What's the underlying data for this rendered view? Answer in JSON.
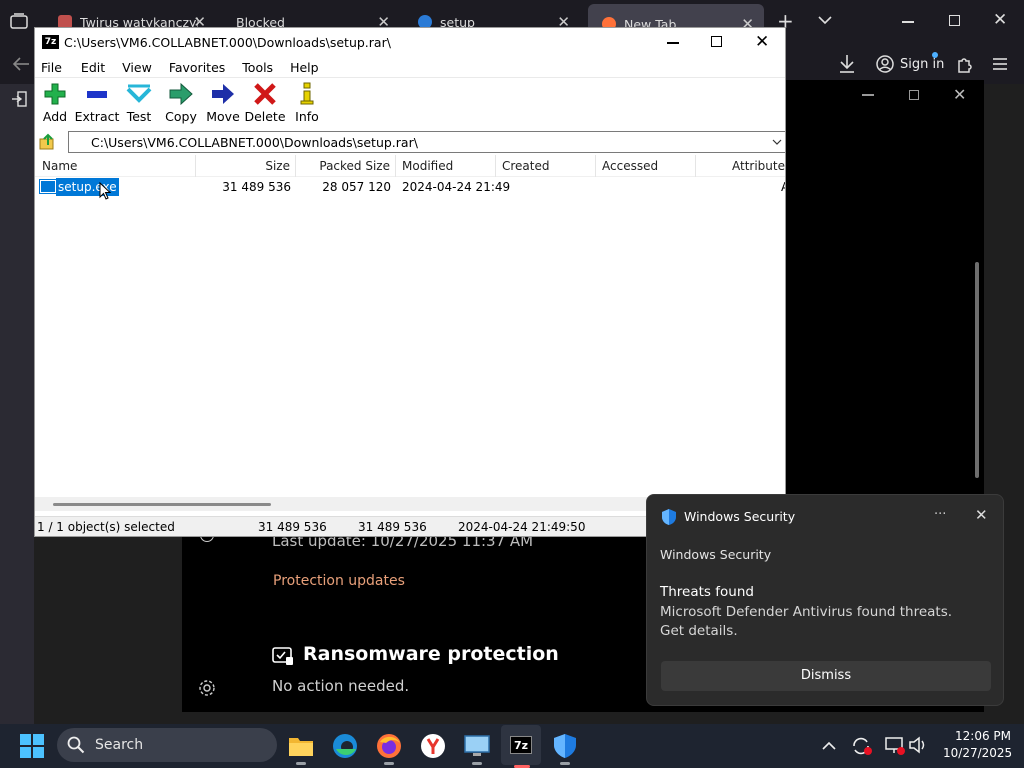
{
  "browser": {
    "tabs": [
      {
        "label": "Twirus watykanczyk link"
      },
      {
        "label": "Blocked"
      },
      {
        "label": "setup"
      },
      {
        "label": "New Tab"
      }
    ],
    "close_glyph": "✕",
    "new_tab_glyph": "+",
    "signin_label": "Sign in"
  },
  "zip": {
    "title": "C:\\Users\\VM6.COLLABNET.000\\Downloads\\setup.rar\\",
    "menu": [
      "File",
      "Edit",
      "View",
      "Favorites",
      "Tools",
      "Help"
    ],
    "toolbar": [
      {
        "label": "Add",
        "icon": "add-icon"
      },
      {
        "label": "Extract",
        "icon": "extract-icon"
      },
      {
        "label": "Test",
        "icon": "test-icon"
      },
      {
        "label": "Copy",
        "icon": "copy-icon"
      },
      {
        "label": "Move",
        "icon": "move-icon"
      },
      {
        "label": "Delete",
        "icon": "delete-icon"
      },
      {
        "label": "Info",
        "icon": "info-icon"
      }
    ],
    "path": "C:\\Users\\VM6.COLLABNET.000\\Downloads\\setup.rar\\",
    "columns": [
      "Name",
      "Size",
      "Packed Size",
      "Modified",
      "Created",
      "Accessed",
      "Attribute"
    ],
    "rows": [
      {
        "name": "setup.exe",
        "size": "31 489 536",
        "packed": "28 057 120",
        "modified": "2024-04-24 21:49",
        "created": "",
        "accessed": "",
        "attr": "A"
      }
    ],
    "status": {
      "selected": "1 / 1 object(s) selected",
      "size": "31 489 536",
      "packed": "31 489 536",
      "modified": "2024-04-24 21:49:50"
    }
  },
  "security": {
    "last_update": "Last update: 10/27/2025 11:37 AM",
    "protection_link": "Protection updates",
    "ransomware_title": "Ransomware protection",
    "ransomware_status": "No action needed."
  },
  "toast": {
    "app": "Windows Security",
    "subtitle": "Windows Security",
    "title": "Threats found",
    "body": "Microsoft Defender Antivirus found threats. Get details.",
    "dismiss": "Dismiss",
    "more_glyph": "···"
  },
  "taskbar": {
    "search_label": "Search",
    "time": "12:06 PM",
    "date": "10/27/2025"
  },
  "colors": {
    "accent": "#0078d4",
    "selection": "#0078d7",
    "link_orange": "#e8a07a",
    "firefox_orange": "#ff7139"
  }
}
